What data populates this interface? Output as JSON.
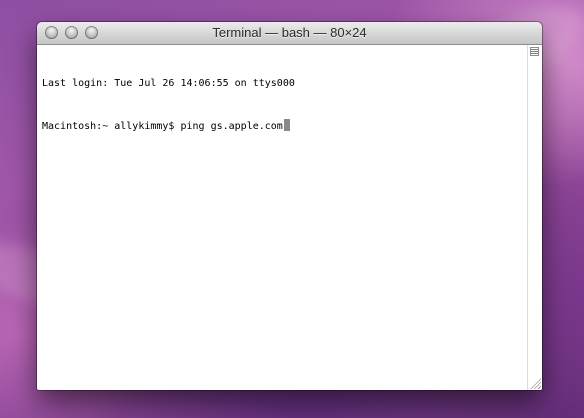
{
  "window": {
    "title": "Terminal — bash — 80×24",
    "controls": [
      "close",
      "minimize",
      "zoom"
    ]
  },
  "terminal": {
    "lines": [
      "Last login: Tue Jul 26 14:06:55 on ttys000",
      "Macintosh:~ allykimmy$ ping gs.apple.com"
    ]
  },
  "icons": {
    "split_pane": "split-pane-icon",
    "resize": "resize-grip-icon"
  },
  "colors": {
    "titlebar": "#d8d8d8",
    "terminal_bg": "#ffffff",
    "terminal_text": "#000000",
    "cursor": "#8a8a8a"
  }
}
